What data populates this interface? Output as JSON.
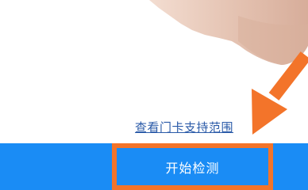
{
  "support_link": {
    "label": "查看门卡支持范围"
  },
  "primary_action": {
    "label": "开始检测"
  },
  "colors": {
    "accent_blue": "#1a8cf5",
    "link_blue": "#2a5aa8",
    "annotation_orange": "#f3742a",
    "skin": "#e8ccbd"
  },
  "icons": {
    "hand": "hand-illustration",
    "annotation": "annotation-arrow-icon"
  }
}
